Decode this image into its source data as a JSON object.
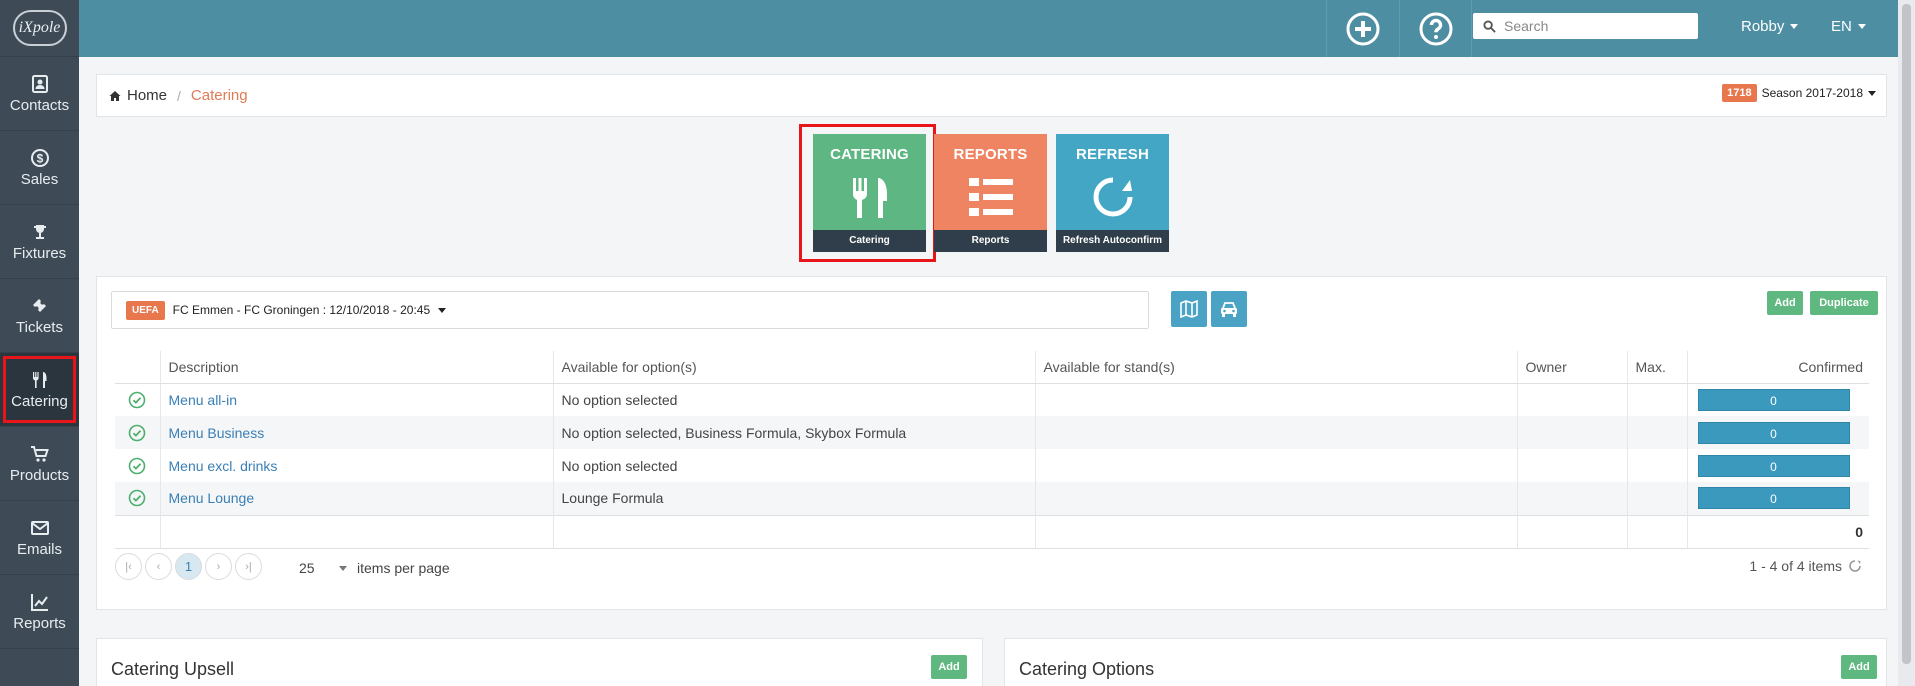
{
  "brand": {
    "logo_text": "iXpole"
  },
  "sidebar": {
    "items": [
      {
        "label": "Contacts",
        "icon": "contacts-icon"
      },
      {
        "label": "Sales",
        "icon": "dollar-icon"
      },
      {
        "label": "Fixtures",
        "icon": "trophy-icon"
      },
      {
        "label": "Tickets",
        "icon": "ticket-icon"
      },
      {
        "label": "Catering",
        "icon": "cutlery-icon",
        "active": true
      },
      {
        "label": "Products",
        "icon": "cart-icon"
      },
      {
        "label": "Emails",
        "icon": "envelope-icon"
      },
      {
        "label": "Reports",
        "icon": "chart-icon"
      }
    ]
  },
  "topbar": {
    "search_placeholder": "Search",
    "user": "Robby",
    "language": "EN"
  },
  "breadcrumb": {
    "home": "Home",
    "separator": "/",
    "current": "Catering"
  },
  "season": {
    "badge": "1718",
    "label": "Season 2017-2018"
  },
  "tiles": [
    {
      "title": "CATERING",
      "footer": "Catering",
      "color": "#5eb782"
    },
    {
      "title": "REPORTS",
      "footer": "Reports",
      "color": "#ee8462"
    },
    {
      "title": "REFRESH",
      "footer": "Refresh Autoconfirm",
      "color": "#42a6c4"
    }
  ],
  "match": {
    "badge": "UEFA",
    "label": "FC Emmen - FC Groningen : 12/10/2018 - 20:45"
  },
  "actions": {
    "add": "Add",
    "duplicate": "Duplicate"
  },
  "table": {
    "headers": [
      "Description",
      "Available for option(s)",
      "Available for stand(s)",
      "Owner",
      "Max.",
      "Confirmed"
    ],
    "rows": [
      {
        "description": "Menu all-in",
        "options": "No option selected",
        "stands": "",
        "owner": "",
        "max": "",
        "confirmed": "0"
      },
      {
        "description": "Menu Business",
        "options": "No option selected, Business Formula, Skybox Formula",
        "stands": "",
        "owner": "",
        "max": "",
        "confirmed": "0"
      },
      {
        "description": "Menu excl. drinks",
        "options": "No option selected",
        "stands": "",
        "owner": "",
        "max": "",
        "confirmed": "0"
      },
      {
        "description": "Menu Lounge",
        "options": "Lounge Formula",
        "stands": "",
        "owner": "",
        "max": "",
        "confirmed": "0"
      }
    ],
    "total_confirmed": "0"
  },
  "pager": {
    "current_page": "1",
    "page_size": "25",
    "items_per_page_label": "items per page",
    "info": "1 - 4 of 4 items"
  },
  "bottom": {
    "upsell_title": "Catering Upsell",
    "options_title": "Catering Options",
    "add_label": "Add"
  }
}
